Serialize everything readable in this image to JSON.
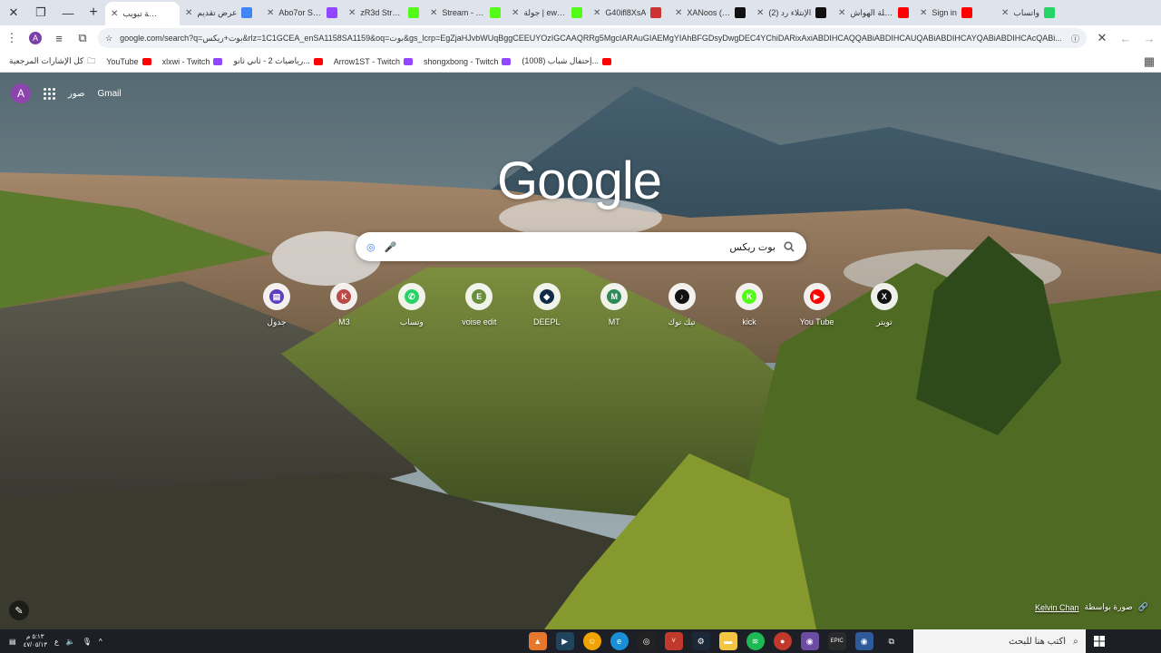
{
  "browser": {
    "tabs": [
      {
        "title": "واتساب",
        "icon": "whatsapp-icon",
        "color": "#25d366"
      },
      {
        "title": "Sign in",
        "icon": "youtube-icon",
        "color": "#ff0000"
      },
      {
        "title": "شيلة الهواش",
        "icon": "youtube-icon",
        "color": "#ff0000"
      },
      {
        "title": "(2) الإنتلاء رد",
        "icon": "x-icon",
        "color": "#111111"
      },
      {
        "title": "XANoos (@",
        "icon": "x-icon",
        "color": "#111111"
      },
      {
        "title": "G40ifl8XsA",
        "icon": "ext-icon",
        "color": "#cc3333"
      },
      {
        "title": "جولة | ewlah",
        "icon": "kick-icon",
        "color": "#53fc18"
      },
      {
        "title": "Stream - Kic",
        "icon": "kick-icon",
        "color": "#53fc18"
      },
      {
        "title": "zR3d Stream",
        "icon": "kick-icon",
        "color": "#53fc18"
      },
      {
        "title": "Abo7or Stre",
        "icon": "twitch-icon",
        "color": "#9146ff"
      },
      {
        "title": "عرض تقديم",
        "icon": "google-icon",
        "color": "#4285f4"
      },
      {
        "title": "علامة تبويب",
        "icon": "newtab-icon",
        "color": "#ffffff",
        "active": true
      }
    ],
    "address": {
      "url": "google.com/search?q=بوت+ريكس&rlz=1C1GCEA_enSA1158SA1159&oq=بوت&gs_lcrp=EgZjaHJvbWUqBggCEEUYOzIGCAAQRRg5MgcIARAuGIAEMgYIAhBFGDsyDwgDEC4YChiDARixAxiABDIHCAQQABiABDIHCAUQABiABDIHCAYQABiABDIHCAcQABi..."
    },
    "bookmarks": {
      "all_label": "كل الإشارات المرجعية",
      "items": [
        {
          "label": "(1008) إحتفال شباب...",
          "color": "#ff0000"
        },
        {
          "label": "shongxbong - Twitch",
          "color": "#9146ff"
        },
        {
          "label": "Arrow1ST - Twitch",
          "color": "#9146ff"
        },
        {
          "label": "رياضيات 2 - ثاني ثانو...",
          "color": "#ff0000"
        },
        {
          "label": "xlxwi - Twitch",
          "color": "#9146ff"
        },
        {
          "label": "YouTube",
          "color": "#ff0000"
        }
      ]
    }
  },
  "newtab": {
    "logo_text": "Google",
    "search_query": "بوت ريكس",
    "gmail_label": "Gmail",
    "images_label": "صور",
    "avatar_letter": "A",
    "shortcuts": [
      {
        "label": "جدول",
        "letter": "▤",
        "color": "#5c3fbf"
      },
      {
        "label": "M3",
        "letter": "K",
        "color": "#b94a48"
      },
      {
        "label": "وتساب",
        "letter": "✆",
        "color": "#25d366"
      },
      {
        "label": "voise edit",
        "letter": "E",
        "color": "#6a8f3a"
      },
      {
        "label": "DEEPL",
        "letter": "◆",
        "color": "#0f2b46"
      },
      {
        "label": "MT",
        "letter": "M",
        "color": "#2e8b57"
      },
      {
        "label": "تيك توك",
        "letter": "♪",
        "color": "#111111"
      },
      {
        "label": "kick",
        "letter": "K",
        "color": "#53fc18"
      },
      {
        "label": "You Tube",
        "letter": "▶",
        "color": "#ff0000"
      },
      {
        "label": "تويتر",
        "letter": "X",
        "color": "#111111"
      }
    ],
    "credit_text": "صورة بواسطة",
    "credit_author": "Kelvin Chan"
  },
  "taskbar": {
    "time": "٥:١٣ م",
    "date": "٤٧/٠٥/١٣",
    "lang": "ع",
    "search_placeholder": "اكتب هنا للبحث"
  }
}
